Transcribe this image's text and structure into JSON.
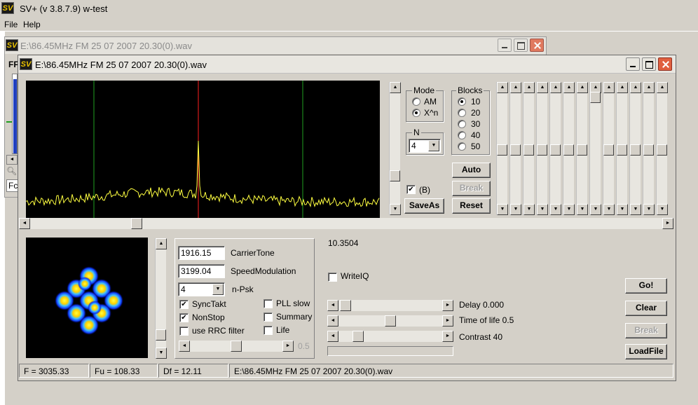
{
  "app": {
    "title": "SV+  (v 3.8.7.9) w-test",
    "logo": "SV"
  },
  "menu": [
    "File",
    "Help"
  ],
  "back_window": {
    "title": "E:\\86.45MHz FM 25 07 2007 20.30(0).wav",
    "side_label": "FF",
    "side_label2": "Fc"
  },
  "window": {
    "title": "E:\\86.45MHz FM 25 07 2007 20.30(0).wav"
  },
  "mode": {
    "title": "Mode",
    "options": [
      "AM",
      "X^n"
    ],
    "selected": 1
  },
  "blocks": {
    "title": "Blocks",
    "options": [
      "10",
      "20",
      "30",
      "40",
      "50"
    ],
    "selected": 0
  },
  "n": {
    "title": "N",
    "value": "4"
  },
  "b_check": {
    "label": "(B)",
    "checked": true
  },
  "buttons": {
    "auto": "Auto",
    "break_top": "Break",
    "saveas": "SaveAs",
    "reset": "Reset",
    "go": "Go!",
    "clear": "Clear",
    "break_bottom": "Break",
    "loadfile": "LoadFile"
  },
  "fields": {
    "carrier_value": "1916.15",
    "carrier_label": "CarrierTone",
    "speed_value": "3199.04",
    "speed_label": "SpeedModulation",
    "npsk_value": "4",
    "npsk_label": "n-Psk"
  },
  "checks": {
    "synctakt": {
      "label": "SyncTakt",
      "checked": true
    },
    "nonstop": {
      "label": "NonStop",
      "checked": true
    },
    "rrc": {
      "label": "use RRC filter",
      "checked": false
    },
    "pll": {
      "label": "PLL slow",
      "checked": false
    },
    "summary": {
      "label": "Summary",
      "checked": false
    },
    "life": {
      "label": "Life",
      "checked": false
    },
    "writeiq": {
      "label": "WriteIQ",
      "checked": false
    }
  },
  "slider_value": "0.5",
  "readout": "10.3504",
  "sliders": {
    "delay": "Delay  0.000",
    "life": "Time of life 0.5",
    "contrast": "Contrast 40"
  },
  "statusbar": [
    "F = 3035.33",
    "Fu = 108.33",
    "Df = 12.11",
    "E:\\86.45MHz FM 25 07 2007 20.30(0).wav"
  ],
  "colors": {
    "spectrum_line": "#ffff40",
    "marker_red": "#ff2020",
    "marker_green": "#20a020",
    "scope_bg": "#000000"
  }
}
